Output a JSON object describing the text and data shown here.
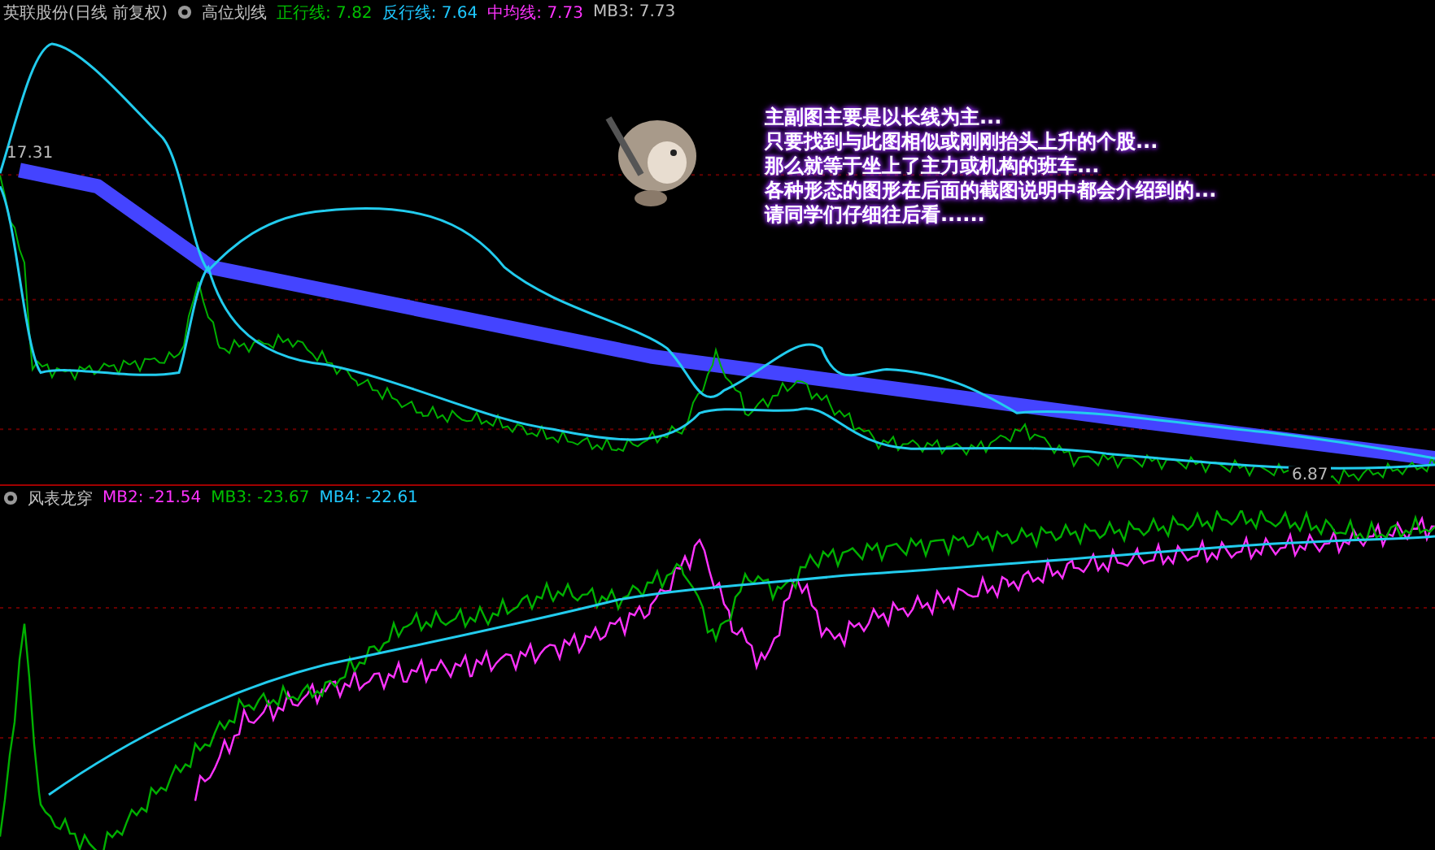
{
  "main_panel": {
    "title": "英联股份(日线 前复权)",
    "indicator": "高位划线",
    "readings": [
      {
        "label": "正行线:",
        "value": "7.82",
        "color": "#00c000"
      },
      {
        "label": "反行线:",
        "value": "7.64",
        "color": "#1ec8ff"
      },
      {
        "label": "中均线:",
        "value": "7.73",
        "color": "#ff33ff"
      },
      {
        "label": "MB3:",
        "value": "7.73",
        "color": "#c0c0c0"
      }
    ],
    "high_label": "17.31",
    "low_label": "6.87",
    "note_lines": [
      "主副图主要是以长线为主...",
      "只要找到与此图相似或刚刚抬头上升的个股...",
      "那么就等于坐上了主力或机构的班车...",
      "各种形态的图形在后面的截图说明中都会介绍到的...",
      "请同学们仔细往后看......"
    ]
  },
  "sub_panel": {
    "title": "风表龙穿",
    "readings": [
      {
        "label": "MB2:",
        "value": "-21.54",
        "color": "#ff33ff"
      },
      {
        "label": "MB3:",
        "value": "-23.67",
        "color": "#00c000"
      },
      {
        "label": "MB4:",
        "value": "-22.61",
        "color": "#1ec8ff"
      }
    ]
  }
}
